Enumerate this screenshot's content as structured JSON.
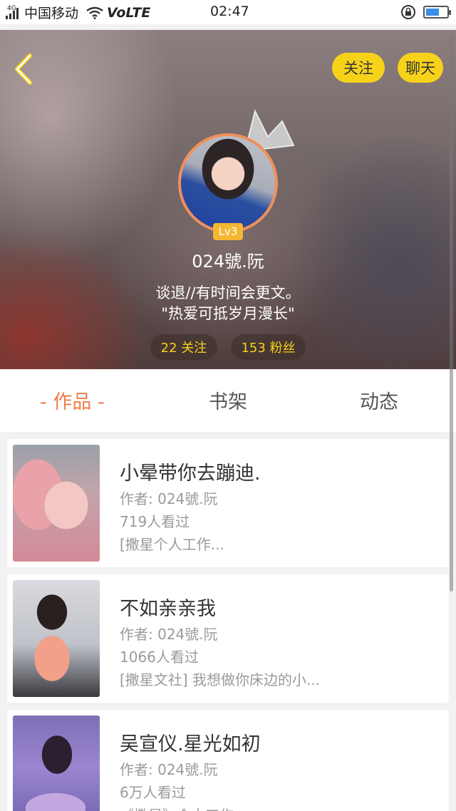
{
  "status_bar": {
    "network_type": "4G",
    "carrier": "中国移动",
    "volte": "VoLTE",
    "time": "02:47",
    "battery_level": 0.65,
    "icons": [
      "signal-icon",
      "wifi-icon",
      "rotation-lock-icon",
      "battery-icon"
    ]
  },
  "profile": {
    "follow_button": "关注",
    "chat_button": "聊天",
    "level": "Lv3",
    "username": "024號.阮",
    "bio_line1": "谈退//有时间会更文。",
    "bio_line2": "\"热爱可抵岁月漫长\"",
    "following": "22 关注",
    "fans": "153 粉丝",
    "accent_color": "#f7d21a"
  },
  "tabs": [
    {
      "label": "- 作品 -",
      "active": true
    },
    {
      "label": "书架",
      "active": false
    },
    {
      "label": "动态",
      "active": false
    }
  ],
  "works": [
    {
      "title": "小晕带你去蹦迪.",
      "author": "作者: 024號.阮",
      "views": "719人看过",
      "desc": "[撒星个人工作..."
    },
    {
      "title": "不如亲亲我",
      "author": "作者: 024號.阮",
      "views": "1066人看过",
      "desc": "[撒星文社] 我想做你床边的小..."
    },
    {
      "title": "吴宣仪.星光如初",
      "author": "作者: 024號.阮",
      "views": "6万人看过",
      "desc": "《撒星》个人工作..."
    }
  ],
  "colors": {
    "active_tab": "#ef7d46",
    "button_yellow": "#f7d21a",
    "level_badge": "#f5b731"
  }
}
